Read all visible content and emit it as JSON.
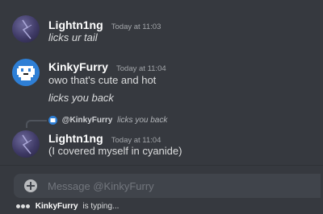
{
  "messages": [
    {
      "author": "Lightn1ng",
      "timestamp": "Today at 11:03",
      "lines": [
        "licks ur tail"
      ]
    },
    {
      "author": "KinkyFurry",
      "timestamp": "Today at 11:04",
      "lines": [
        "owo that's cute and hot",
        "licks you back"
      ]
    },
    {
      "reply_to": {
        "author": "@KinkyFurry",
        "text": "licks you back"
      },
      "author": "Lightn1ng",
      "timestamp": "Today at 11:04",
      "lines": [
        "(I covered myself in cyanide)"
      ]
    }
  ],
  "composer": {
    "placeholder": "Message @KinkyFurry"
  },
  "typing": {
    "user": "KinkyFurry",
    "suffix": "is typing..."
  },
  "colors": {
    "background": "#36393f",
    "input_background": "#40444b",
    "username": "#ffffff",
    "message_text": "#dcddde",
    "timestamp": "#a3a6aa",
    "kinkyfurry_avatar": "#2e7fd6"
  },
  "icons": {
    "composer_add": "plus-circle-icon",
    "typing_indicator": "typing-dots-icon"
  }
}
